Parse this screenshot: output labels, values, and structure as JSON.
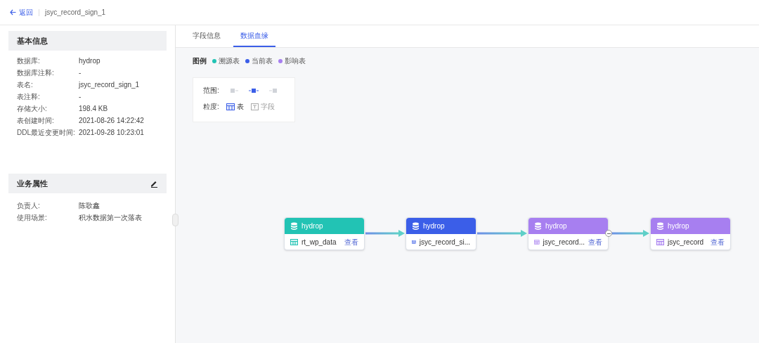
{
  "header": {
    "back": "返回",
    "title": "jsyc_record_sign_1"
  },
  "basic_info": {
    "title": "基本信息",
    "fields": [
      {
        "label": "数据库:",
        "value": "hydrop"
      },
      {
        "label": "数据库注释:",
        "value": "-"
      },
      {
        "label": "表名:",
        "value": "jsyc_record_sign_1"
      },
      {
        "label": "表注释:",
        "value": "-"
      },
      {
        "label": "存储大小:",
        "value": "198.4 KB"
      },
      {
        "label": "表创建时间:",
        "value": "2021-08-26 14:22:42"
      },
      {
        "label": "DDL最近变更时间:",
        "value": "2021-09-28 10:23:01"
      }
    ]
  },
  "business": {
    "title": "业务属性",
    "fields": [
      {
        "label": "负责人:",
        "value": "陈歌鑫"
      },
      {
        "label": "使用场景:",
        "value": "积水数据第一次落表"
      }
    ]
  },
  "tabs": [
    {
      "label": "字段信息",
      "selected": false
    },
    {
      "label": "数据血缘",
      "selected": true
    }
  ],
  "legend": {
    "label": "图例",
    "items": [
      {
        "label": "溯源表",
        "color": "#22c3b4"
      },
      {
        "label": "当前表",
        "color": "#3b5ee8"
      },
      {
        "label": "影响表",
        "color": "#a77ff0"
      }
    ]
  },
  "controls": {
    "range_label": "范围:",
    "range_options": [
      {
        "kind": "upstream",
        "selected": false
      },
      {
        "kind": "both",
        "selected": true
      },
      {
        "kind": "downstream",
        "selected": false
      }
    ],
    "granularity_label": "粒度:",
    "granularity_options": [
      {
        "kind": "table",
        "label": "表",
        "selected": true
      },
      {
        "kind": "field",
        "label": "字段",
        "selected": false
      }
    ]
  },
  "nodes": [
    {
      "database": "hydrop",
      "table": "rt_wp_data",
      "action": "查看",
      "color": "#22c3b4",
      "expanded": false
    },
    {
      "database": "hydrop",
      "table": "jsyc_record_si...",
      "color": "#3b5ee8",
      "expanded": false
    },
    {
      "database": "hydrop",
      "table": "jsyc_record...",
      "action": "查看",
      "color": "#a77ff0",
      "expanded": true
    },
    {
      "database": "hydrop",
      "table": "jsyc_record",
      "action": "查看",
      "color": "#a77ff0",
      "expanded": false
    }
  ]
}
